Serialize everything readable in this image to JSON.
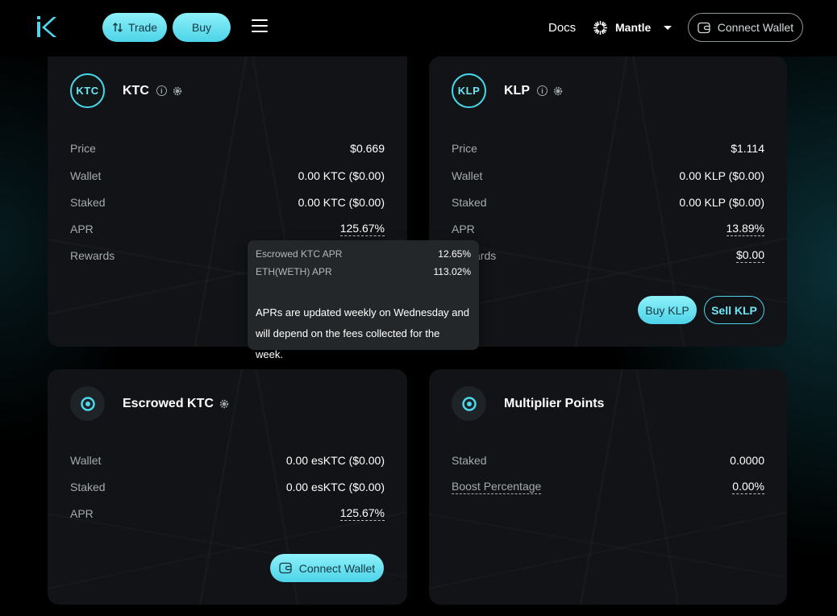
{
  "header": {
    "trade_label": "Trade",
    "buy_label": "Buy",
    "docs_label": "Docs",
    "network_name": "Mantle",
    "connect_wallet_label": "Connect Wallet"
  },
  "ktc_card": {
    "icon_text": "KTC",
    "title": "KTC",
    "rows": [
      {
        "label": "Price",
        "value": "$0.669"
      },
      {
        "label": "Wallet",
        "value": "0.00 KTC ($0.00)"
      },
      {
        "label": "Staked",
        "value": "0.00 KTC ($0.00)"
      },
      {
        "label": "APR",
        "value": "125.67%"
      },
      {
        "label": "Rewards",
        "value": ""
      }
    ]
  },
  "klp_card": {
    "icon_text": "KLP",
    "title": "KLP",
    "rows": [
      {
        "label": "Price",
        "value": "$1.114"
      },
      {
        "label": "Wallet",
        "value": "0.00 KLP ($0.00)"
      },
      {
        "label": "Staked",
        "value": "0.00 KLP ($0.00)"
      },
      {
        "label": "APR",
        "value": "13.89%"
      },
      {
        "label": "Rewards",
        "value": "$0.00"
      }
    ],
    "buy_label": "Buy KLP",
    "sell_label": "Sell KLP"
  },
  "tooltip": {
    "rows": [
      {
        "label": "Escrowed KTC APR",
        "value": "12.65%"
      },
      {
        "label": "ETH(WETH) APR",
        "value": "113.02%"
      }
    ],
    "note": "APRs are updated weekly on Wednesday and will depend on the fees collected for the week."
  },
  "esktc_card": {
    "title": "Escrowed KTC",
    "rows": [
      {
        "label": "Wallet",
        "value": "0.00 esKTC ($0.00)"
      },
      {
        "label": "Staked",
        "value": "0.00 esKTC ($0.00)"
      },
      {
        "label": "APR",
        "value": "125.67%"
      }
    ],
    "connect_wallet_label": "Connect Wallet"
  },
  "mp_card": {
    "title": "Multiplier Points",
    "rows": [
      {
        "label": "Staked",
        "value": "0.0000"
      },
      {
        "label": "Boost Percentage",
        "value": "0.00%"
      }
    ]
  },
  "colors": {
    "accent": "#4cd3e8",
    "accent_light": "#8ef1f9",
    "card_bg": "#121316",
    "tooltip_bg": "#242729"
  }
}
